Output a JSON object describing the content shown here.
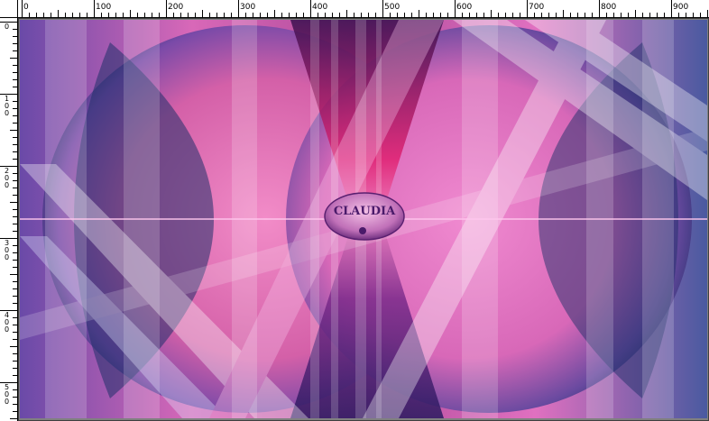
{
  "rulers": {
    "horizontal": [
      "0",
      "100",
      "200",
      "300",
      "400",
      "500",
      "600",
      "700",
      "800",
      "900"
    ],
    "vertical": [
      "0",
      "100",
      "200",
      "300",
      "400",
      "500"
    ]
  },
  "image": {
    "watermark_text": "CLAUDIA",
    "colors": {
      "magenta": "#e0569a",
      "pink": "#f07ac0",
      "navy": "#1f2f6a",
      "purple": "#7a4aa8",
      "lavender": "#c8a8e0"
    }
  }
}
